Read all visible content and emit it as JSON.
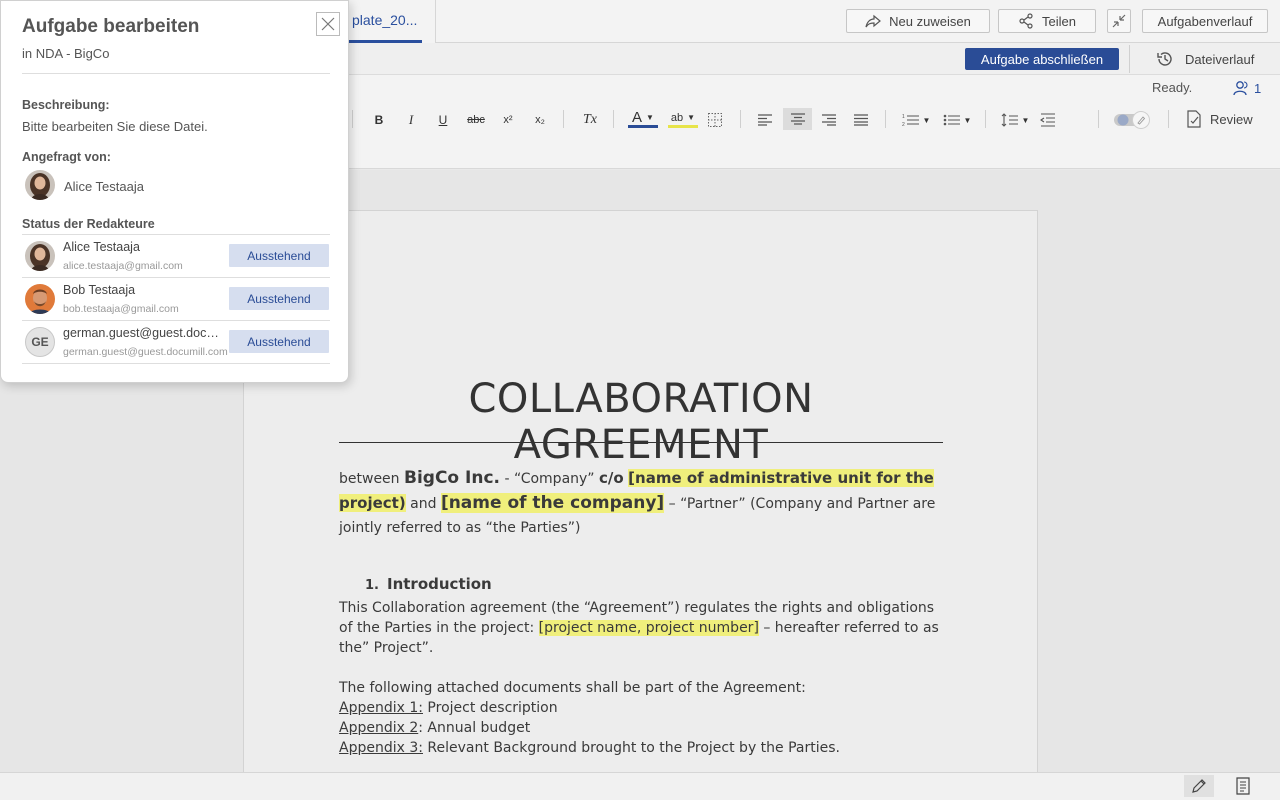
{
  "tab": {
    "label": "plate_20..."
  },
  "top_actions": {
    "reassign": "Neu zuweisen",
    "share": "Teilen",
    "task_history": "Aufgabenverlauf"
  },
  "bar2": {
    "complete_task": "Aufgabe abschließen",
    "file_history": "Dateiverlauf"
  },
  "toolbar": {
    "ready": "Ready.",
    "users_count": "1",
    "review": "Review",
    "bold": "B",
    "italic": "I",
    "underline": "U",
    "strike": "abc",
    "superscript": "x²",
    "subscript": "x₂",
    "clear_format": "Tx",
    "font_color": "A",
    "highlight": "ab"
  },
  "document": {
    "title": "COLLABORATION AGREEMENT",
    "p1": {
      "between": "between ",
      "bigco": "BigCo Inc.",
      "company": " - “Company” ",
      "co": "c/o",
      "space": " ",
      "unit": "[name of administrative unit for the project)",
      "and": " and ",
      "company_name": "[name of the company]",
      "rest": " – “Partner” (Company and Partner are jointly referred to as “the Parties”)"
    },
    "section": {
      "num": "1.",
      "title": "Introduction"
    },
    "p2": {
      "a": "This Collaboration agreement (the “Agreement”) regulates the rights and obligations of the Parties in the project: ",
      "hl": "[project name, project number]",
      "b": " – hereafter referred to as the” Project”."
    },
    "p3": {
      "intro": "The following attached documents shall be part of the Agreement:",
      "a1_label": "Appendix 1:",
      "a1_text": " Project description",
      "a2_label": "Appendix 2",
      "a2_text": ": Annual budget",
      "a3_label": "Appendix 3:",
      "a3_text": " Relevant Background brought to the Project by the Parties."
    }
  },
  "panel": {
    "title": "Aufgabe bearbeiten",
    "subtitle": "in NDA - BigCo",
    "description_label": "Beschreibung:",
    "description": "Bitte bearbeiten Sie diese Datei.",
    "requested_label": "Angefragt von:",
    "requested_by": "Alice Testaaja",
    "editors_label": "Status der Redakteure",
    "editors": [
      {
        "name": "Alice Testaaja",
        "email": "alice.testaaja@gmail.com",
        "status": "Ausstehend"
      },
      {
        "name": "Bob Testaaja",
        "email": "bob.testaaja@gmail.com",
        "status": "Ausstehend"
      },
      {
        "name": "german.guest@guest.documill.com",
        "email": "german.guest@guest.documill.com",
        "status": "Ausstehend",
        "initials": "GE"
      }
    ]
  }
}
